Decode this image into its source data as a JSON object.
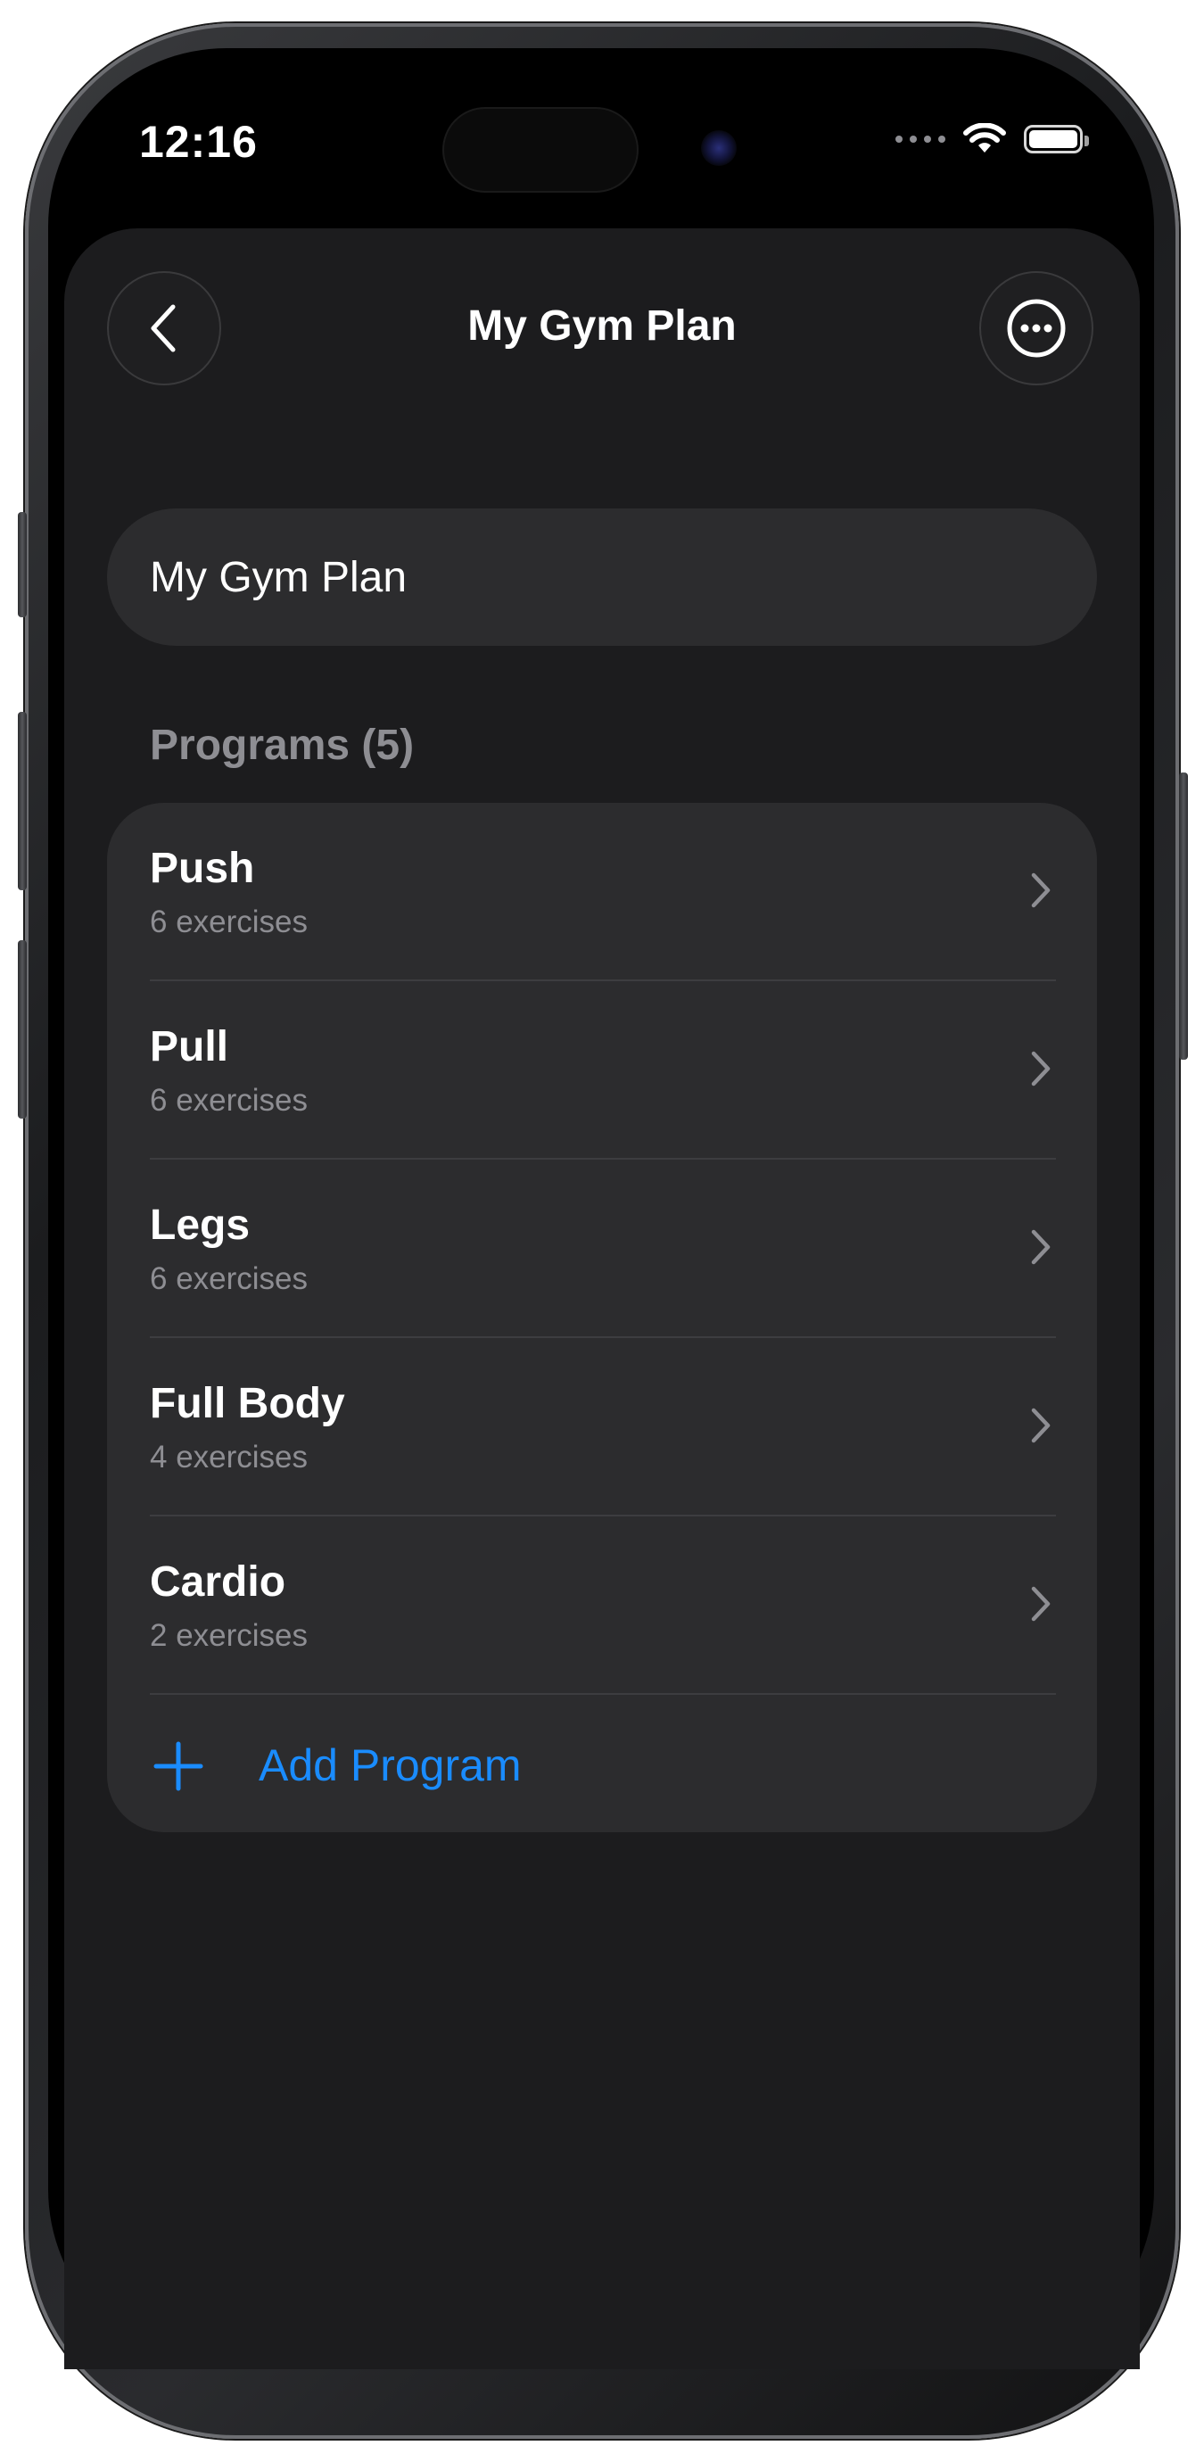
{
  "status_bar": {
    "time": "12:16"
  },
  "nav": {
    "title": "My Gym Plan",
    "back_icon": "chevron-left-icon",
    "more_icon": "ellipsis-circle-icon"
  },
  "plan_name_field": {
    "value": "My Gym Plan"
  },
  "programs": {
    "header": "Programs (5)",
    "items": [
      {
        "title": "Push",
        "subtitle": "6 exercises"
      },
      {
        "title": "Pull",
        "subtitle": "6 exercises"
      },
      {
        "title": "Legs",
        "subtitle": "6 exercises"
      },
      {
        "title": "Full Body",
        "subtitle": "4 exercises"
      },
      {
        "title": "Cardio",
        "subtitle": "2 exercises"
      }
    ],
    "add_label": "Add Program"
  },
  "colors": {
    "accent": "#1a8cff",
    "background": "#1c1c1e",
    "card": "#2c2c2e",
    "secondary_text": "#8e8e93"
  }
}
